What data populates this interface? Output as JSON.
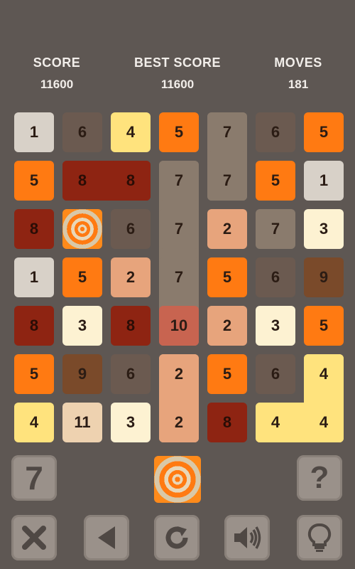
{
  "header": {
    "score_label": "SCORE",
    "score_value": "11600",
    "best_label": "BEST SCORE",
    "best_value": "11600",
    "moves_label": "MOVES",
    "moves_value": "181"
  },
  "colors": {
    "background": "#5e5753",
    "1": "#d8d1c8",
    "2": "#e7a47c",
    "3": "#fdf2d2",
    "4": "#ffe37d",
    "5": "#ff7a12",
    "6": "#6b5a50",
    "7": "#8a7b6d",
    "8": "#8e2412",
    "9": "#7a4a2a",
    "10": "#c86450",
    "11": "#eed2b0"
  },
  "board": {
    "rows": [
      [
        "1",
        "6",
        "4",
        "5",
        "7",
        "6",
        "5"
      ],
      [
        "5",
        "8",
        "8",
        "7",
        "7",
        "5",
        "1"
      ],
      [
        "8",
        "*",
        "6",
        "7",
        "2",
        "7",
        "3"
      ],
      [
        "1",
        "5",
        "2",
        "7",
        "5",
        "6",
        "9"
      ],
      [
        "8",
        "3",
        "8",
        "10",
        "2",
        "3",
        "5"
      ],
      [
        "5",
        "9",
        "6",
        "2",
        "5",
        "6",
        "4"
      ],
      [
        "4",
        "11",
        "3",
        "2",
        "8",
        "4",
        "4"
      ]
    ]
  },
  "controls": {
    "next_tile": "7",
    "help_label": "?",
    "special_tile_icon": "swirl-bomb-icon",
    "toolbar_icons": [
      "close-icon",
      "back-arrow-icon",
      "restart-icon",
      "sound-icon",
      "hint-bulb-icon"
    ]
  }
}
